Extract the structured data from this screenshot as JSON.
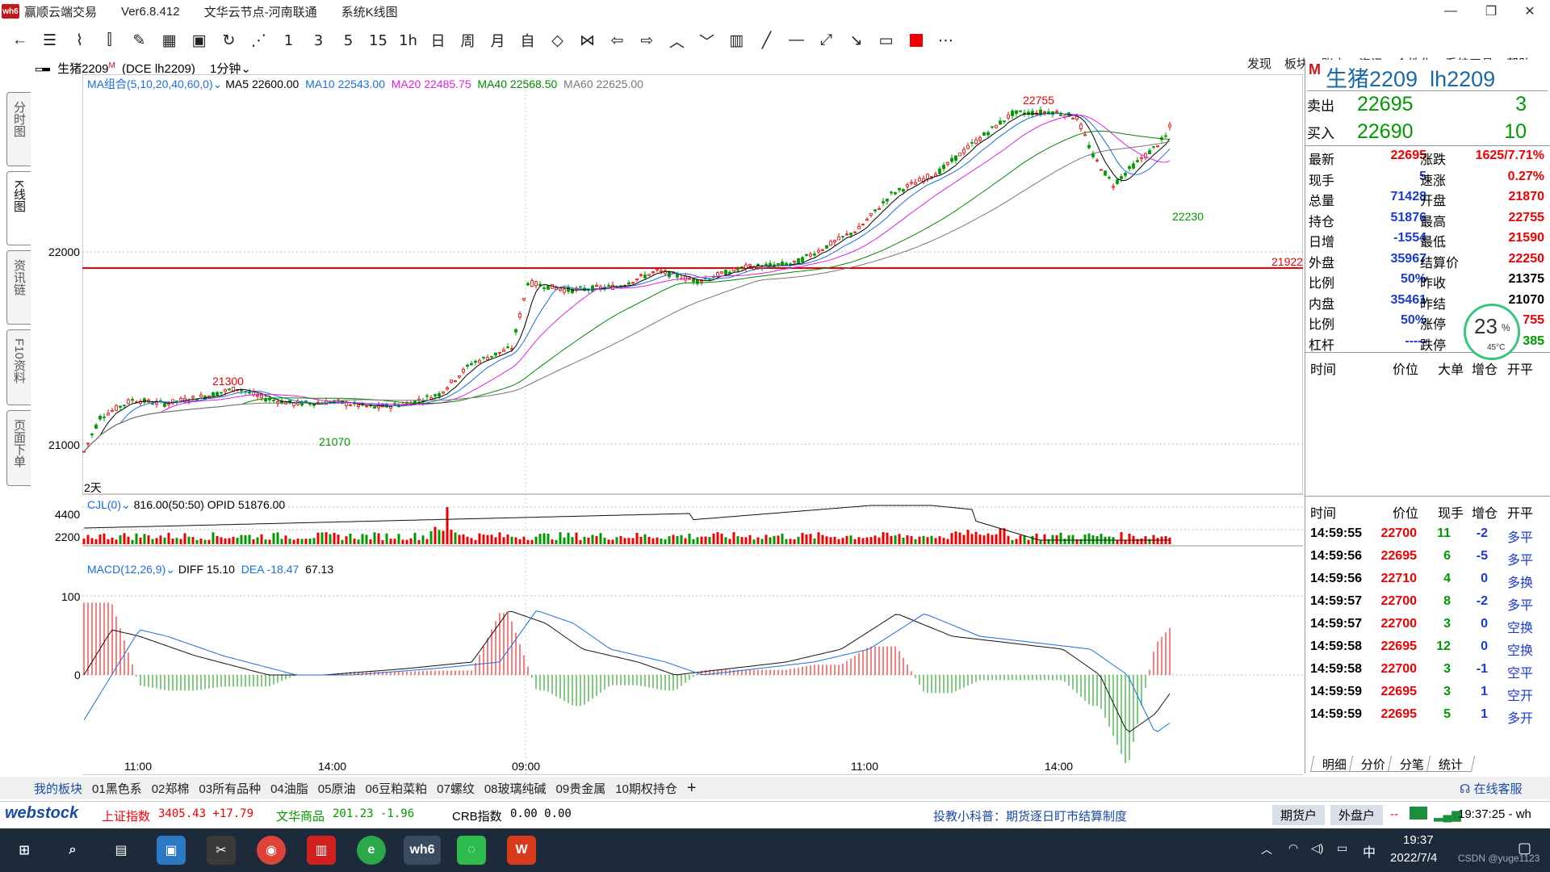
{
  "window": {
    "app_name": "赢顺云端交易",
    "version": "Ver6.8.412",
    "node": "文华云节点-河南联通",
    "view": "系统K线图"
  },
  "toolbar": {
    "period_labels": [
      "1",
      "3",
      "5",
      "15",
      "1h",
      "日",
      "周",
      "月",
      "自"
    ],
    "right_menu": [
      "发现",
      "板块",
      "账户",
      "资讯",
      "个性化",
      "系统工具",
      "帮助"
    ]
  },
  "left_tabs": [
    "分时图",
    "K线图",
    "资讯链",
    "F10资料",
    "页面下单"
  ],
  "chart": {
    "header_symbol": "生猪2209",
    "header_super": "M",
    "header_code": "(DCE lh2209)",
    "period": "1分钟",
    "ma_label": "MA组合(5,10,20,40,60,0)",
    "ma5": "MA5 22600.00",
    "ma10": "MA10 22543.00",
    "ma20": "MA20 22485.75",
    "ma40": "MA40 22568.50",
    "ma60": "MA60 22625.00",
    "y_ticks": [
      "22000",
      "21000"
    ],
    "marker_high": "22755",
    "marker_21300": "21300",
    "marker_21070": "21070",
    "marker_low": "22230",
    "hline_value": "21922",
    "days_label": "2天",
    "vol_label": "CJL(0)",
    "vol_values": "816.00(50:50)  OPID 51876.00",
    "vol_ticks": [
      "4400",
      "2200"
    ],
    "macd_label": "MACD(12,26,9)",
    "diff": "DIFF 15.10",
    "dea": "DEA -18.47",
    "macd_value": "67.13",
    "macd_ticks": [
      "100",
      "0"
    ],
    "x_ticks": [
      "11:00",
      "14:00",
      "09:00",
      "11:00",
      "14:00"
    ]
  },
  "quote": {
    "badge": "M",
    "name": "生猪2209",
    "code": "lh2209",
    "ask_label": "卖出",
    "ask_price": "22695",
    "ask_vol": "3",
    "bid_label": "买入",
    "bid_price": "22690",
    "bid_vol": "10",
    "stats": [
      {
        "l1": "最新",
        "v1": "22695",
        "c1": "red",
        "l2": "涨跌",
        "v2": "1625/7.71%",
        "c2": "red"
      },
      {
        "l1": "现手",
        "v1": "5",
        "c1": "blue",
        "l2": "速涨",
        "v2": "0.27%",
        "c2": "red"
      },
      {
        "l1": "总量",
        "v1": "71428",
        "c1": "blue",
        "l2": "开盘",
        "v2": "21870",
        "c2": "red"
      },
      {
        "l1": "持仓",
        "v1": "51876",
        "c1": "blue",
        "l2": "最高",
        "v2": "22755",
        "c2": "red"
      },
      {
        "l1": "日增",
        "v1": "-1554",
        "c1": "blue",
        "l2": "最低",
        "v2": "21590",
        "c2": "red"
      },
      {
        "l1": "外盘",
        "v1": "35967",
        "c1": "blue",
        "l2": "结算价",
        "v2": "22250",
        "c2": "red"
      },
      {
        "l1": "比例",
        "v1": "50%",
        "c1": "blue",
        "l2": "昨收",
        "v2": "21375",
        "c2": "black"
      },
      {
        "l1": "内盘",
        "v1": "35461",
        "c1": "blue",
        "l2": "昨结",
        "v2": "21070",
        "c2": "black"
      },
      {
        "l1": "比例",
        "v1": "50%",
        "c1": "blue",
        "l2": "涨停",
        "v2": "755",
        "c2": "red"
      },
      {
        "l1": "杠杆",
        "v1": "-----",
        "c1": "blue",
        "l2": "跌停",
        "v2": "385",
        "c2": "green"
      }
    ],
    "gauge_value": "23",
    "gauge_unit": "%",
    "gauge_temp": "45°C",
    "hdr1": [
      "时间",
      "价位",
      "大单",
      "增仓",
      "开平"
    ],
    "hdr2": [
      "时间",
      "价位",
      "现手",
      "增仓",
      "开平"
    ],
    "ticks": [
      {
        "time": "14:59:55",
        "price": "22700",
        "vol": "11",
        "oi": "-2",
        "dir": "多平"
      },
      {
        "time": "14:59:56",
        "price": "22695",
        "vol": "6",
        "oi": "-5",
        "dir": "多平"
      },
      {
        "time": "14:59:56",
        "price": "22710",
        "vol": "4",
        "oi": "0",
        "dir": "多换"
      },
      {
        "time": "14:59:57",
        "price": "22700",
        "vol": "8",
        "oi": "-2",
        "dir": "多平"
      },
      {
        "time": "14:59:57",
        "price": "22700",
        "vol": "3",
        "oi": "0",
        "dir": "空换"
      },
      {
        "time": "14:59:58",
        "price": "22695",
        "vol": "12",
        "oi": "0",
        "dir": "空换"
      },
      {
        "time": "14:59:58",
        "price": "22700",
        "vol": "3",
        "oi": "-1",
        "dir": "空平"
      },
      {
        "time": "14:59:59",
        "price": "22695",
        "vol": "3",
        "oi": "1",
        "dir": "空开"
      },
      {
        "time": "14:59:59",
        "price": "22695",
        "vol": "5",
        "oi": "1",
        "dir": "多开"
      }
    ],
    "tabs": [
      "明细",
      "分价",
      "分笔",
      "统计"
    ]
  },
  "blocks": [
    "我的板块",
    "01黑色系",
    "02郑棉",
    "03所有品种",
    "04油脂",
    "05原油",
    "06豆粕菜粕",
    "07螺纹",
    "08玻璃纯碱",
    "09贵金属",
    "10期权持仓"
  ],
  "online_service": "在线客服",
  "status": {
    "brand": "webstock",
    "idx1_name": "上证指数",
    "idx1_val": "3405.43 +17.79",
    "idx2_name": "文华商品",
    "idx2_val": "201.23 -1.96",
    "idx3_name": "CRB指数",
    "idx3_val": "0.00 0.00",
    "tip": "投教小科普：期货逐日盯市结算制度",
    "btn1": "期货户",
    "btn2": "外盘户",
    "dashes": "--",
    "clock": "19:37:25 - wh"
  },
  "taskbar": {
    "time": "19:37",
    "date": "2022/7/4",
    "ime": "中",
    "watermark": "CSDN @yuge1123"
  },
  "colors": {
    "up": "#ee0000",
    "down": "#009900",
    "ma5": "#000000",
    "ma10": "#1a6ee0",
    "ma20": "#e020e0",
    "ma40": "#008800",
    "ma60": "#777777"
  }
}
